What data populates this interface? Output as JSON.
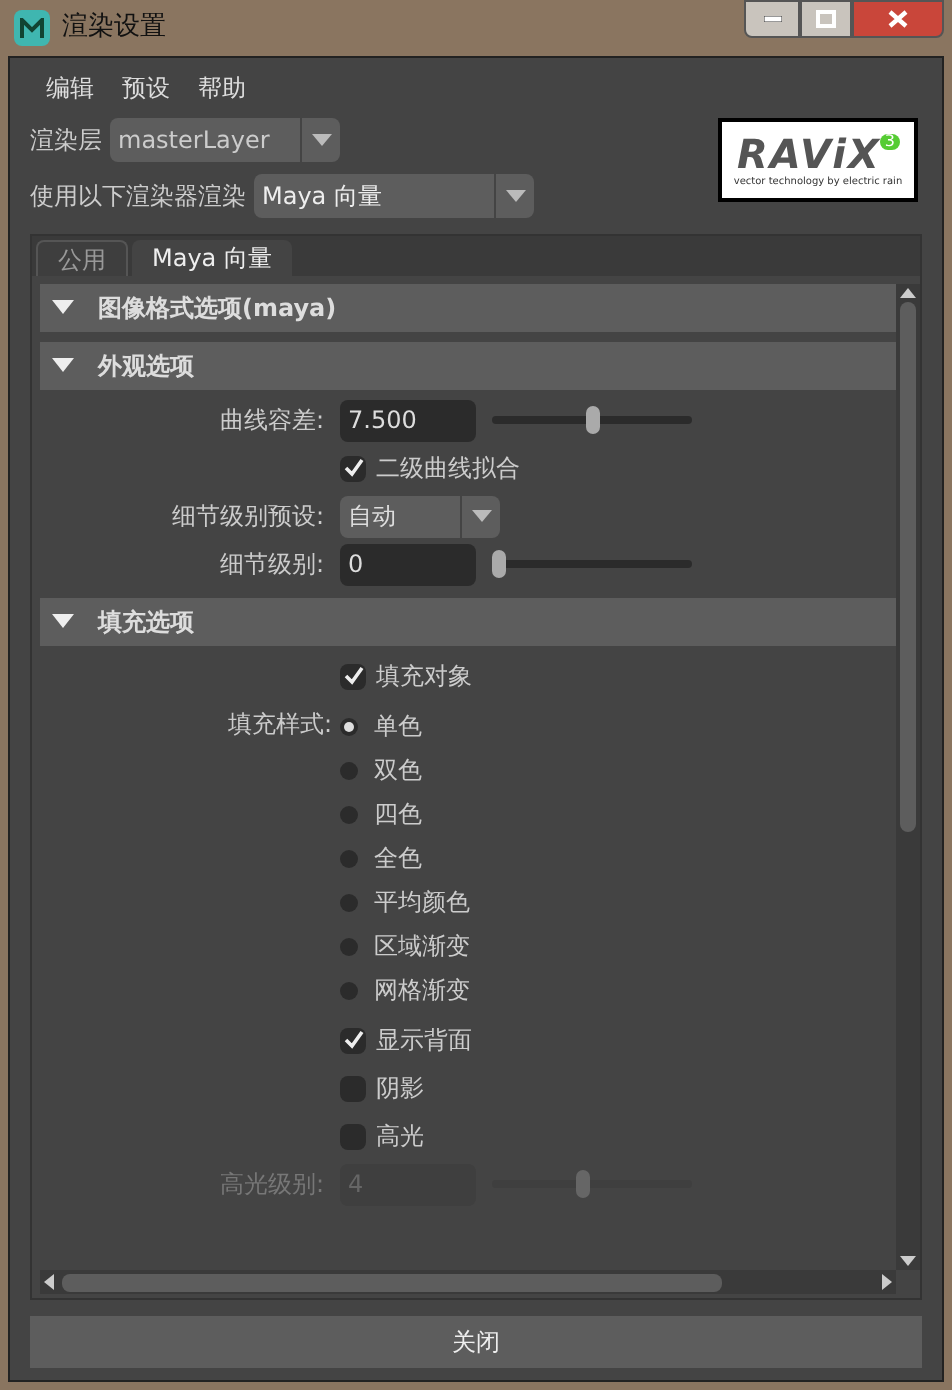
{
  "window": {
    "title": "渲染设置"
  },
  "menu": [
    "编辑",
    "预设",
    "帮助"
  ],
  "render_layer": {
    "label": "渲染层",
    "value": "masterLayer"
  },
  "renderer": {
    "label": "使用以下渲染器渲染",
    "value": "Maya 向量"
  },
  "logo": {
    "name": "RAViX",
    "badge": "3",
    "tagline": "vector technology by electric rain"
  },
  "tabs": [
    {
      "label": "公用",
      "selected": false
    },
    {
      "label": "Maya 向量",
      "selected": true
    }
  ],
  "sections": [
    {
      "title": "图像格式选项(maya)",
      "expanded": true
    },
    {
      "title": "外观选项",
      "expanded": true,
      "rows": [
        {
          "kind": "slider",
          "label": "曲线容差:",
          "value": "7.500",
          "level": 0.5,
          "disabled": false
        },
        {
          "kind": "checkbox",
          "label": "二级曲线拟合",
          "checked": true
        },
        {
          "kind": "dropdown",
          "label": "细节级别预设:",
          "value": "自动"
        },
        {
          "kind": "slider",
          "label": "细节级别:",
          "value": "0",
          "level": 0,
          "disabled": false
        }
      ]
    },
    {
      "title": "填充选项",
      "expanded": true,
      "rows": [
        {
          "kind": "checkbox",
          "label": "填充对象",
          "checked": true
        },
        {
          "kind": "radio",
          "label": "填充样式:",
          "options": [
            {
              "label": "单色",
              "selected": true
            },
            {
              "label": "双色",
              "selected": false
            },
            {
              "label": "四色",
              "selected": false
            },
            {
              "label": "全色",
              "selected": false
            },
            {
              "label": "平均颜色",
              "selected": false
            },
            {
              "label": "区域渐变",
              "selected": false
            },
            {
              "label": "网格渐变",
              "selected": false
            }
          ]
        },
        {
          "kind": "checkbox",
          "label": "显示背面",
          "checked": true
        },
        {
          "kind": "checkbox",
          "label": "阴影",
          "checked": false
        },
        {
          "kind": "checkbox",
          "label": "高光",
          "checked": false
        },
        {
          "kind": "slider",
          "label": "高光级别:",
          "value": "4",
          "level": 0.45,
          "disabled": true
        }
      ]
    }
  ],
  "close_button": "关闭"
}
